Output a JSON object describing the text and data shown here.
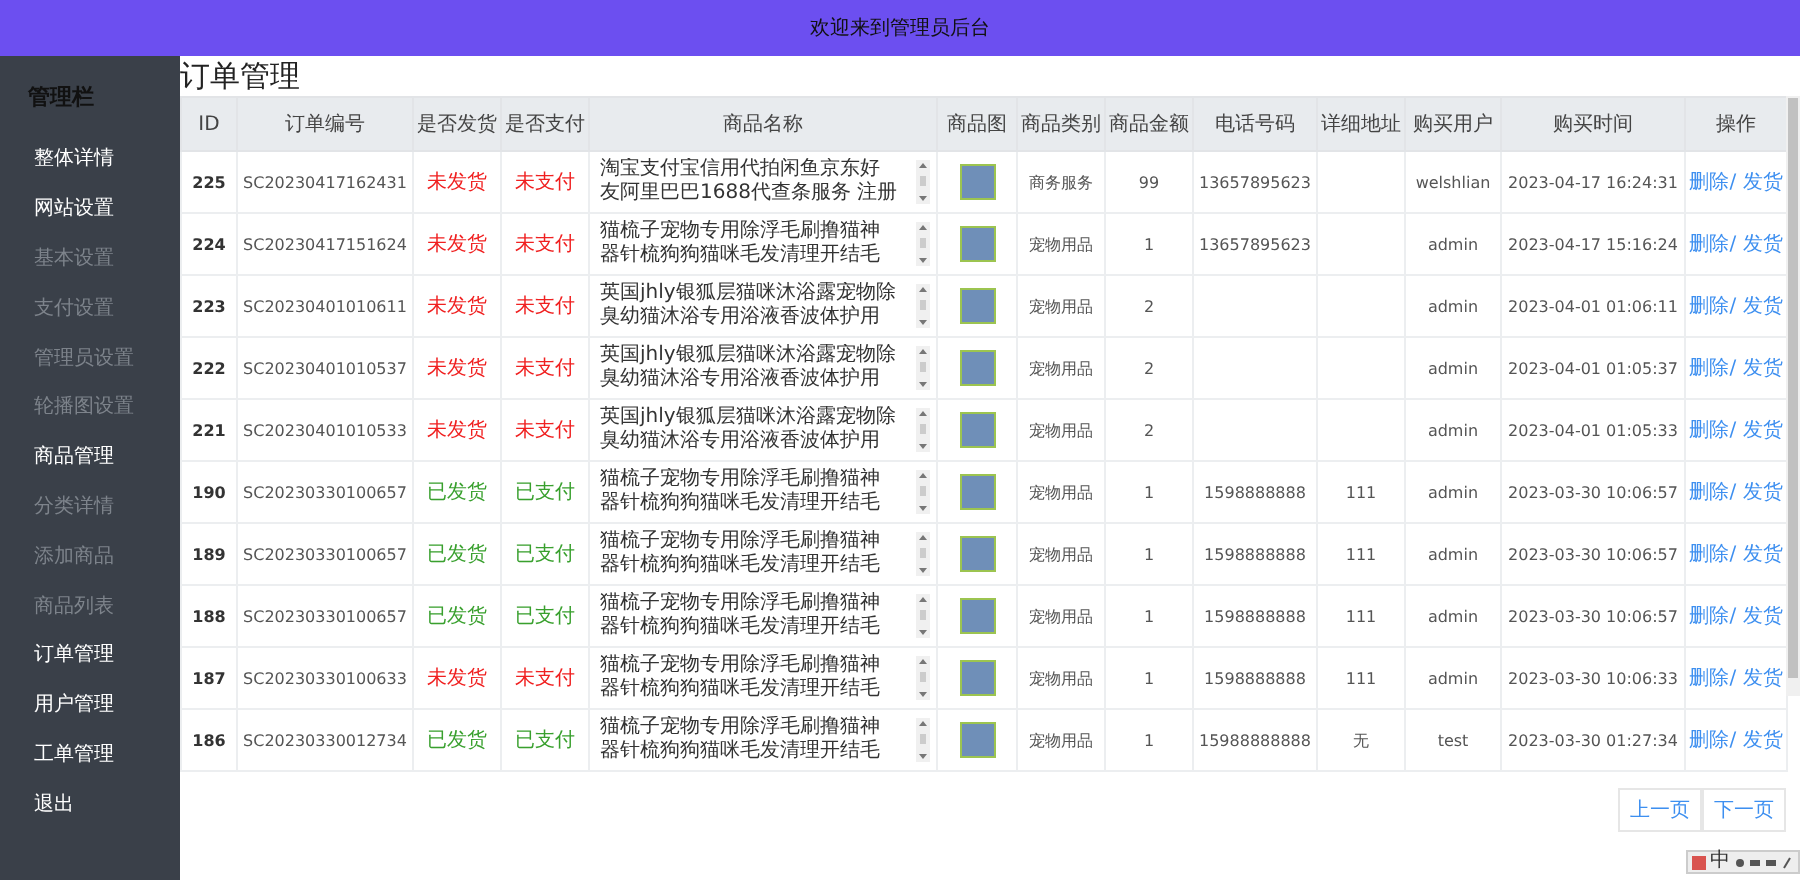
{
  "topbar": {
    "title": "欢迎来到管理员后台"
  },
  "sidebar": {
    "title": "管理栏",
    "items": [
      {
        "label": "整体详情",
        "kind": "section"
      },
      {
        "label": "网站设置",
        "kind": "section"
      },
      {
        "label": "基本设置",
        "kind": "sub"
      },
      {
        "label": "支付设置",
        "kind": "sub"
      },
      {
        "label": "管理员设置",
        "kind": "sub"
      },
      {
        "label": "轮播图设置",
        "kind": "sub"
      },
      {
        "label": "商品管理",
        "kind": "section"
      },
      {
        "label": "分类详情",
        "kind": "sub"
      },
      {
        "label": "添加商品",
        "kind": "sub"
      },
      {
        "label": "商品列表",
        "kind": "sub"
      },
      {
        "label": "订单管理",
        "kind": "section"
      },
      {
        "label": "用户管理",
        "kind": "section"
      },
      {
        "label": "工单管理",
        "kind": "section"
      },
      {
        "label": "退出",
        "kind": "section"
      }
    ]
  },
  "page_title": "订单管理",
  "table": {
    "columns": [
      "ID",
      "订单编号",
      "是否发货",
      "是否支付",
      "商品名称",
      "商品图",
      "商品类别",
      "商品金额",
      "电话号码",
      "详细地址",
      "购买用户",
      "购买时间",
      "操作"
    ],
    "rows": [
      {
        "id": "225",
        "order_no": "SC20230417162431",
        "shipping": "未发货",
        "shipped": false,
        "payment": "未支付",
        "paid": false,
        "product_lines": [
          "淘宝支付宝信用代拍闲鱼京东好",
          "友阿里巴巴1688代查条服务 注册"
        ],
        "category": "商务服务",
        "amount": "99",
        "phone": "13657895623",
        "address": "",
        "user": "welshlian",
        "time": "2023-04-17 16:24:31",
        "delete": "删除/",
        "ship": "发货"
      },
      {
        "id": "224",
        "order_no": "SC20230417151624",
        "shipping": "未发货",
        "shipped": false,
        "payment": "未支付",
        "paid": false,
        "product_lines": [
          "猫梳子宠物专用除浮毛刷撸猫神",
          "器针梳狗狗猫咪毛发清理开结毛"
        ],
        "category": "宠物用品",
        "amount": "1",
        "phone": "13657895623",
        "address": "",
        "user": "admin",
        "time": "2023-04-17 15:16:24",
        "delete": "删除/",
        "ship": "发货"
      },
      {
        "id": "223",
        "order_no": "SC20230401010611",
        "shipping": "未发货",
        "shipped": false,
        "payment": "未支付",
        "paid": false,
        "product_lines": [
          "英国jhly银狐层猫咪沐浴露宠物除",
          "臭幼猫沐浴专用浴液香波体护用"
        ],
        "category": "宠物用品",
        "amount": "2",
        "phone": "",
        "address": "",
        "user": "admin",
        "time": "2023-04-01 01:06:11",
        "delete": "删除/",
        "ship": "发货"
      },
      {
        "id": "222",
        "order_no": "SC20230401010537",
        "shipping": "未发货",
        "shipped": false,
        "payment": "未支付",
        "paid": false,
        "product_lines": [
          "英国jhly银狐层猫咪沐浴露宠物除",
          "臭幼猫沐浴专用浴液香波体护用"
        ],
        "category": "宠物用品",
        "amount": "2",
        "phone": "",
        "address": "",
        "user": "admin",
        "time": "2023-04-01 01:05:37",
        "delete": "删除/",
        "ship": "发货"
      },
      {
        "id": "221",
        "order_no": "SC20230401010533",
        "shipping": "未发货",
        "shipped": false,
        "payment": "未支付",
        "paid": false,
        "product_lines": [
          "英国jhly银狐层猫咪沐浴露宠物除",
          "臭幼猫沐浴专用浴液香波体护用"
        ],
        "category": "宠物用品",
        "amount": "2",
        "phone": "",
        "address": "",
        "user": "admin",
        "time": "2023-04-01 01:05:33",
        "delete": "删除/",
        "ship": "发货"
      },
      {
        "id": "190",
        "order_no": "SC20230330100657",
        "shipping": "已发货",
        "shipped": true,
        "payment": "已支付",
        "paid": true,
        "product_lines": [
          "猫梳子宠物专用除浮毛刷撸猫神",
          "器针梳狗狗猫咪毛发清理开结毛"
        ],
        "category": "宠物用品",
        "amount": "1",
        "phone": "1598888888",
        "address": "111",
        "user": "admin",
        "time": "2023-03-30 10:06:57",
        "delete": "删除/",
        "ship": "发货"
      },
      {
        "id": "189",
        "order_no": "SC20230330100657",
        "shipping": "已发货",
        "shipped": true,
        "payment": "已支付",
        "paid": true,
        "product_lines": [
          "猫梳子宠物专用除浮毛刷撸猫神",
          "器针梳狗狗猫咪毛发清理开结毛"
        ],
        "category": "宠物用品",
        "amount": "1",
        "phone": "1598888888",
        "address": "111",
        "user": "admin",
        "time": "2023-03-30 10:06:57",
        "delete": "删除/",
        "ship": "发货"
      },
      {
        "id": "188",
        "order_no": "SC20230330100657",
        "shipping": "已发货",
        "shipped": true,
        "payment": "已支付",
        "paid": true,
        "product_lines": [
          "猫梳子宠物专用除浮毛刷撸猫神",
          "器针梳狗狗猫咪毛发清理开结毛"
        ],
        "category": "宠物用品",
        "amount": "1",
        "phone": "1598888888",
        "address": "111",
        "user": "admin",
        "time": "2023-03-30 10:06:57",
        "delete": "删除/",
        "ship": "发货"
      },
      {
        "id": "187",
        "order_no": "SC20230330100633",
        "shipping": "未发货",
        "shipped": false,
        "payment": "未支付",
        "paid": false,
        "product_lines": [
          "猫梳子宠物专用除浮毛刷撸猫神",
          "器针梳狗狗猫咪毛发清理开结毛"
        ],
        "category": "宠物用品",
        "amount": "1",
        "phone": "1598888888",
        "address": "111",
        "user": "admin",
        "time": "2023-03-30 10:06:33",
        "delete": "删除/",
        "ship": "发货"
      },
      {
        "id": "186",
        "order_no": "SC20230330012734",
        "shipping": "已发货",
        "shipped": true,
        "payment": "已支付",
        "paid": true,
        "product_lines": [
          "猫梳子宠物专用除浮毛刷撸猫神",
          "器针梳狗狗猫咪毛发清理开结毛"
        ],
        "category": "宠物用品",
        "amount": "1",
        "phone": "15988888888",
        "address": "无",
        "user": "test",
        "time": "2023-03-30 01:27:34",
        "delete": "删除/",
        "ship": "发货"
      }
    ]
  },
  "pagination": {
    "prev": "上一页",
    "next": "下一页"
  },
  "ime_bar": {
    "mode": "中"
  }
}
